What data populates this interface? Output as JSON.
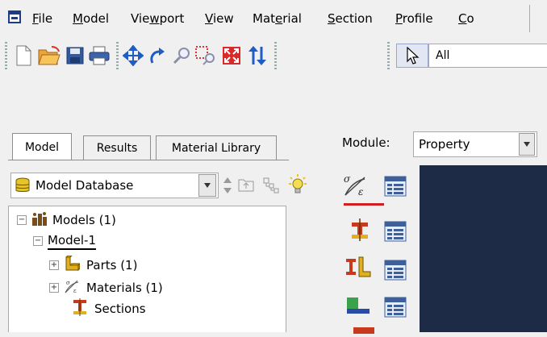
{
  "menubar": {
    "items": [
      {
        "label": "File",
        "underline": "F",
        "rest": "ile"
      },
      {
        "label": "Model",
        "underline": "M",
        "rest": "odel"
      },
      {
        "label": "Viewport",
        "pre": "Vie",
        "underline": "w",
        "rest": "port"
      },
      {
        "label": "View",
        "underline": "V",
        "rest": "iew"
      },
      {
        "label": "Material",
        "pre": "Mat",
        "underline": "e",
        "rest": "rial"
      },
      {
        "label": "Section",
        "underline": "S",
        "rest": "ection"
      },
      {
        "label": "Profile",
        "underline": "P",
        "rest": "rofile"
      },
      {
        "label": "Co",
        "underline": "C",
        "rest": "o"
      }
    ]
  },
  "toolbar": {
    "icons": [
      "new-file-icon",
      "open-folder-icon",
      "save-icon",
      "print-icon",
      "pan-icon",
      "rotate-icon",
      "zoom-icon",
      "box-zoom-icon",
      "auto-fit-icon",
      "cycle-views-icon",
      "select-arrow-icon"
    ],
    "selection_value": "All"
  },
  "tabs": [
    {
      "label": "Model",
      "active": true
    },
    {
      "label": "Results",
      "active": false
    },
    {
      "label": "Material Library",
      "active": false
    }
  ],
  "database": {
    "label": "Model Database"
  },
  "tree": {
    "items": [
      {
        "label": "Models (1)",
        "expander": "−"
      },
      {
        "label": "Model-1",
        "expander": "−"
      },
      {
        "label": "Parts (1)",
        "expander": "+"
      },
      {
        "label": "Materials (1)",
        "expander": "+"
      },
      {
        "label": "Sections",
        "expander": ""
      }
    ]
  },
  "module": {
    "label": "Module:",
    "value": "Property"
  },
  "toolbox": {
    "icons": [
      "create-material-icon",
      "material-manager-icon",
      "create-section-icon",
      "section-manager-icon",
      "assign-section-icon",
      "assign-manager-icon",
      "beam-profile-icon",
      "profile-manager-icon"
    ]
  },
  "colors": {
    "viewport_bg": "#1d2b46",
    "underline_red": "#d21e1e"
  }
}
